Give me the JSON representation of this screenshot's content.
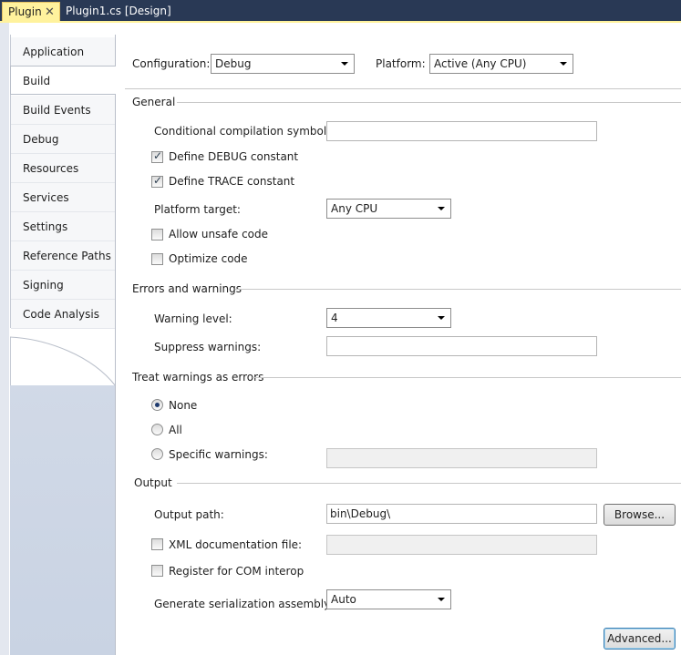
{
  "tabs": {
    "active": "Plugin",
    "close_glyph": "✕",
    "inactive": "Plugin1.cs [Design]"
  },
  "nav": {
    "items": [
      {
        "label": "Application"
      },
      {
        "label": "Build"
      },
      {
        "label": "Build Events"
      },
      {
        "label": "Debug"
      },
      {
        "label": "Resources"
      },
      {
        "label": "Services"
      },
      {
        "label": "Settings"
      },
      {
        "label": "Reference Paths"
      },
      {
        "label": "Signing"
      },
      {
        "label": "Code Analysis"
      }
    ],
    "selected": "Build"
  },
  "config": {
    "configuration_label": "Configuration:",
    "configuration_value": "Debug",
    "platform_label": "Platform:",
    "platform_value": "Active (Any CPU)"
  },
  "general": {
    "title": "General",
    "cond_symbols_label": "Conditional compilation symbols:",
    "cond_symbols_value": "",
    "define_debug_label": "Define DEBUG constant",
    "define_debug_checked": true,
    "define_trace_label": "Define TRACE constant",
    "define_trace_checked": true,
    "platform_target_label": "Platform target:",
    "platform_target_value": "Any CPU",
    "allow_unsafe_label": "Allow unsafe code",
    "allow_unsafe_checked": false,
    "optimize_label": "Optimize code",
    "optimize_checked": false
  },
  "errors": {
    "title": "Errors and warnings",
    "warning_level_label": "Warning level:",
    "warning_level_value": "4",
    "suppress_label": "Suppress warnings:",
    "suppress_value": ""
  },
  "treat": {
    "title": "Treat warnings as errors",
    "none_label": "None",
    "all_label": "All",
    "specific_label": "Specific warnings:",
    "selected": "None",
    "specific_value": ""
  },
  "output": {
    "title": "Output",
    "path_label": "Output path:",
    "path_value": "bin\\Debug\\",
    "browse_label": "Browse...",
    "xml_doc_label": "XML documentation file:",
    "xml_doc_checked": false,
    "xml_doc_value": "",
    "com_interop_label": "Register for COM interop",
    "com_interop_checked": false,
    "serialization_label": "Generate serialization assembly:",
    "serialization_value": "Auto",
    "advanced_label": "Advanced..."
  },
  "icons": {
    "check": "✓"
  }
}
